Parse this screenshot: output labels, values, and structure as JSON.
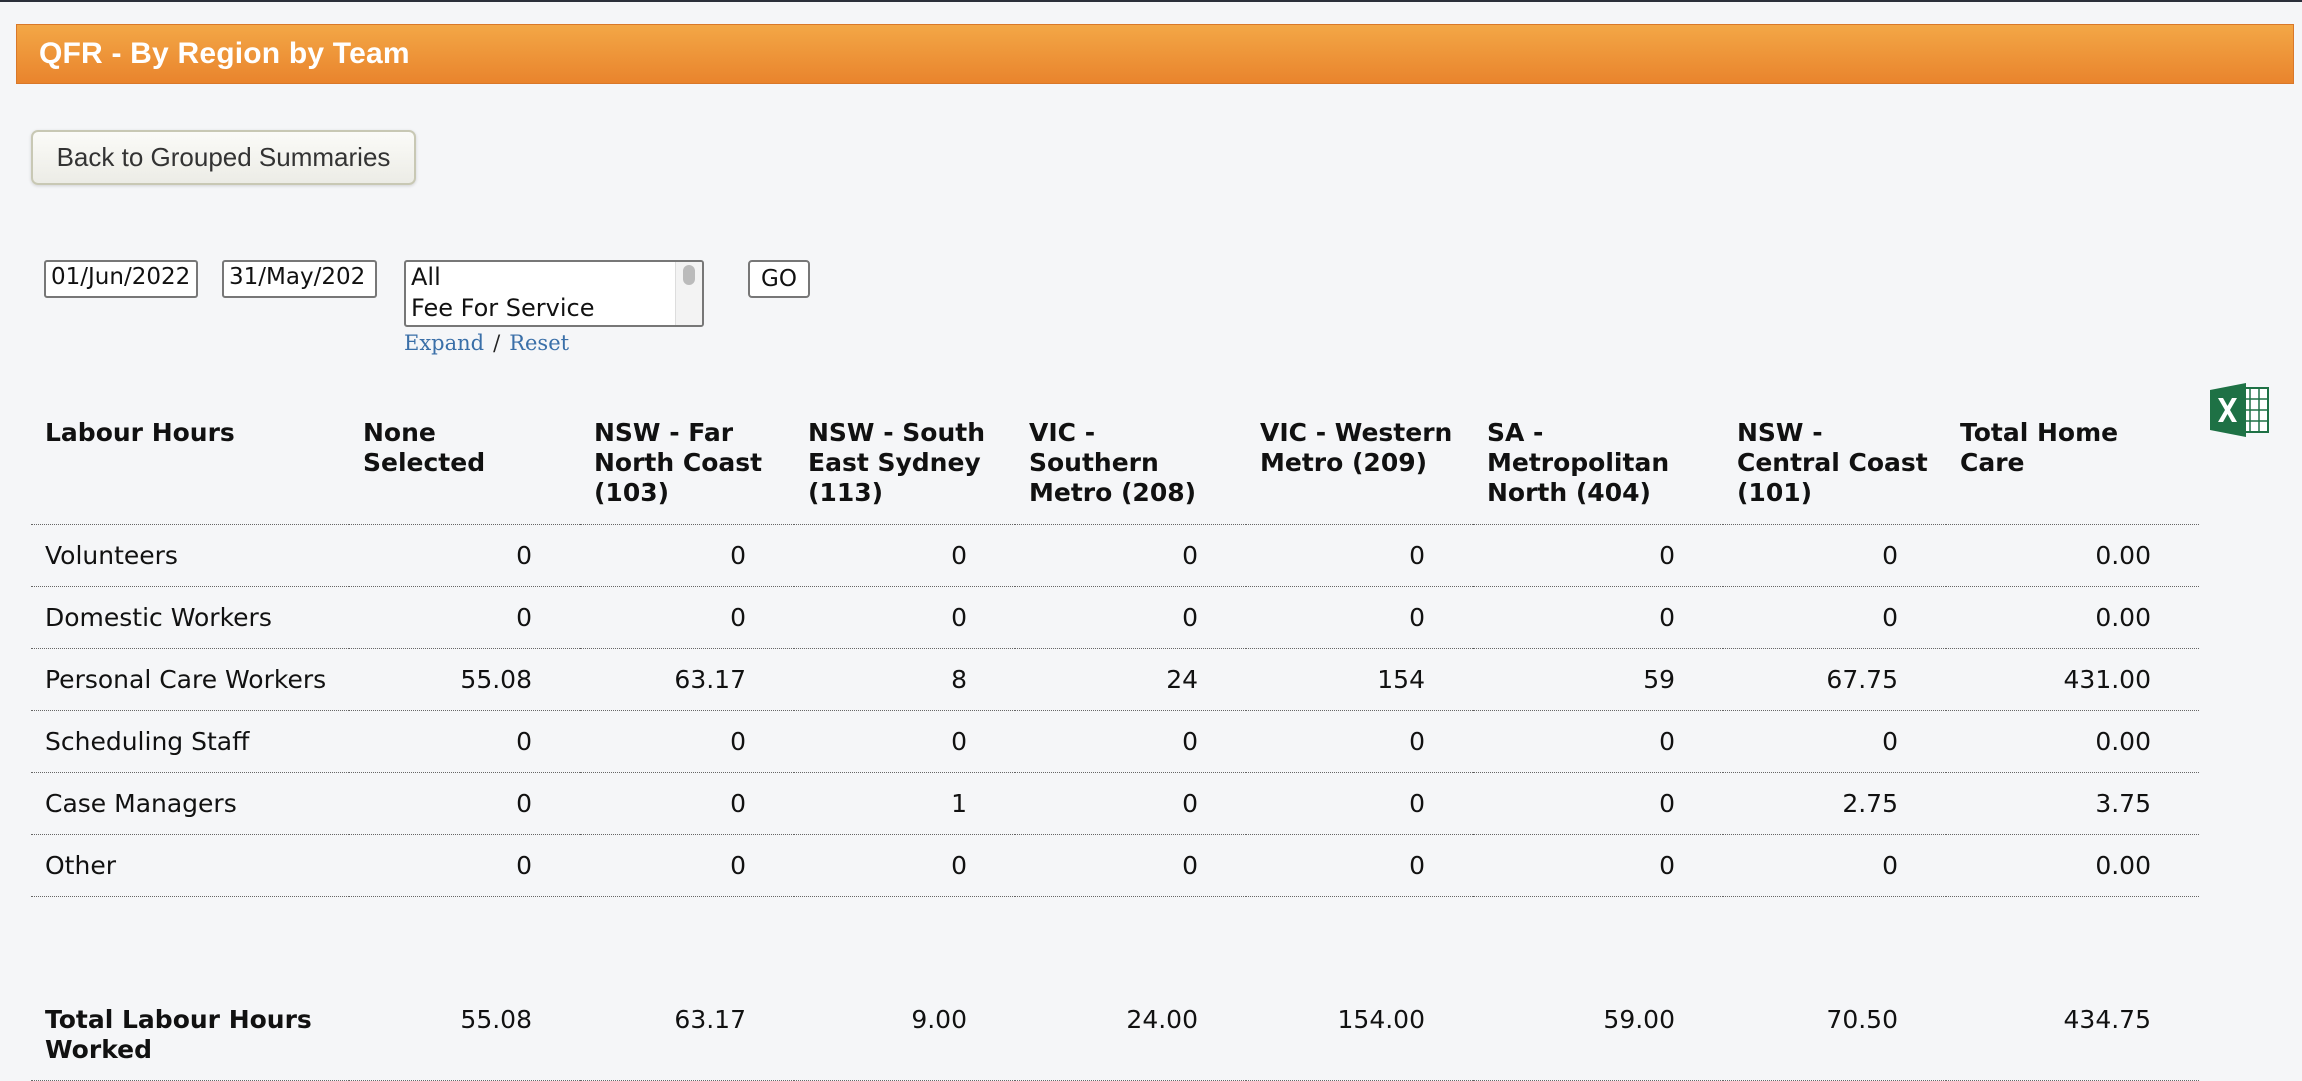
{
  "page": {
    "title": "QFR - By Region by Team"
  },
  "nav": {
    "back_label": "Back to Grouped Summaries"
  },
  "filters": {
    "start_date": "01/Jun/2022",
    "end_date": "31/May/202",
    "funding_options": [
      "All",
      "Fee For Service"
    ],
    "expand_label": "Expand",
    "reset_label": "Reset",
    "separator": "/",
    "go_label": "GO"
  },
  "export": {
    "icon": "excel-icon",
    "color": "#1e7145"
  },
  "table": {
    "headers": [
      "Labour Hours",
      "None Selected",
      "NSW - Far North Coast (103)",
      "NSW - South East Sydney (113)",
      "VIC - Southern Metro (208)",
      "VIC - Western Metro (209)",
      "SA - Metropolitan North (404)",
      "NSW - Central Coast (101)",
      "Total Home Care"
    ],
    "rows": [
      {
        "label": "Volunteers",
        "values": [
          "0",
          "0",
          "0",
          "0",
          "0",
          "0",
          "0",
          "0.00"
        ]
      },
      {
        "label": "Domestic Workers",
        "values": [
          "0",
          "0",
          "0",
          "0",
          "0",
          "0",
          "0",
          "0.00"
        ]
      },
      {
        "label": "Personal Care Workers",
        "values": [
          "55.08",
          "63.17",
          "8",
          "24",
          "154",
          "59",
          "67.75",
          "431.00"
        ]
      },
      {
        "label": "Scheduling Staff",
        "values": [
          "0",
          "0",
          "0",
          "0",
          "0",
          "0",
          "0",
          "0.00"
        ]
      },
      {
        "label": "Case Managers",
        "values": [
          "0",
          "0",
          "1",
          "0",
          "0",
          "0",
          "2.75",
          "3.75"
        ]
      },
      {
        "label": "Other",
        "values": [
          "0",
          "0",
          "0",
          "0",
          "0",
          "0",
          "0",
          "0.00"
        ]
      }
    ],
    "total": {
      "label": "Total Labour Hours Worked",
      "values": [
        "55.08",
        "63.17",
        "9.00",
        "24.00",
        "154.00",
        "59.00",
        "70.50",
        "434.75"
      ]
    }
  }
}
